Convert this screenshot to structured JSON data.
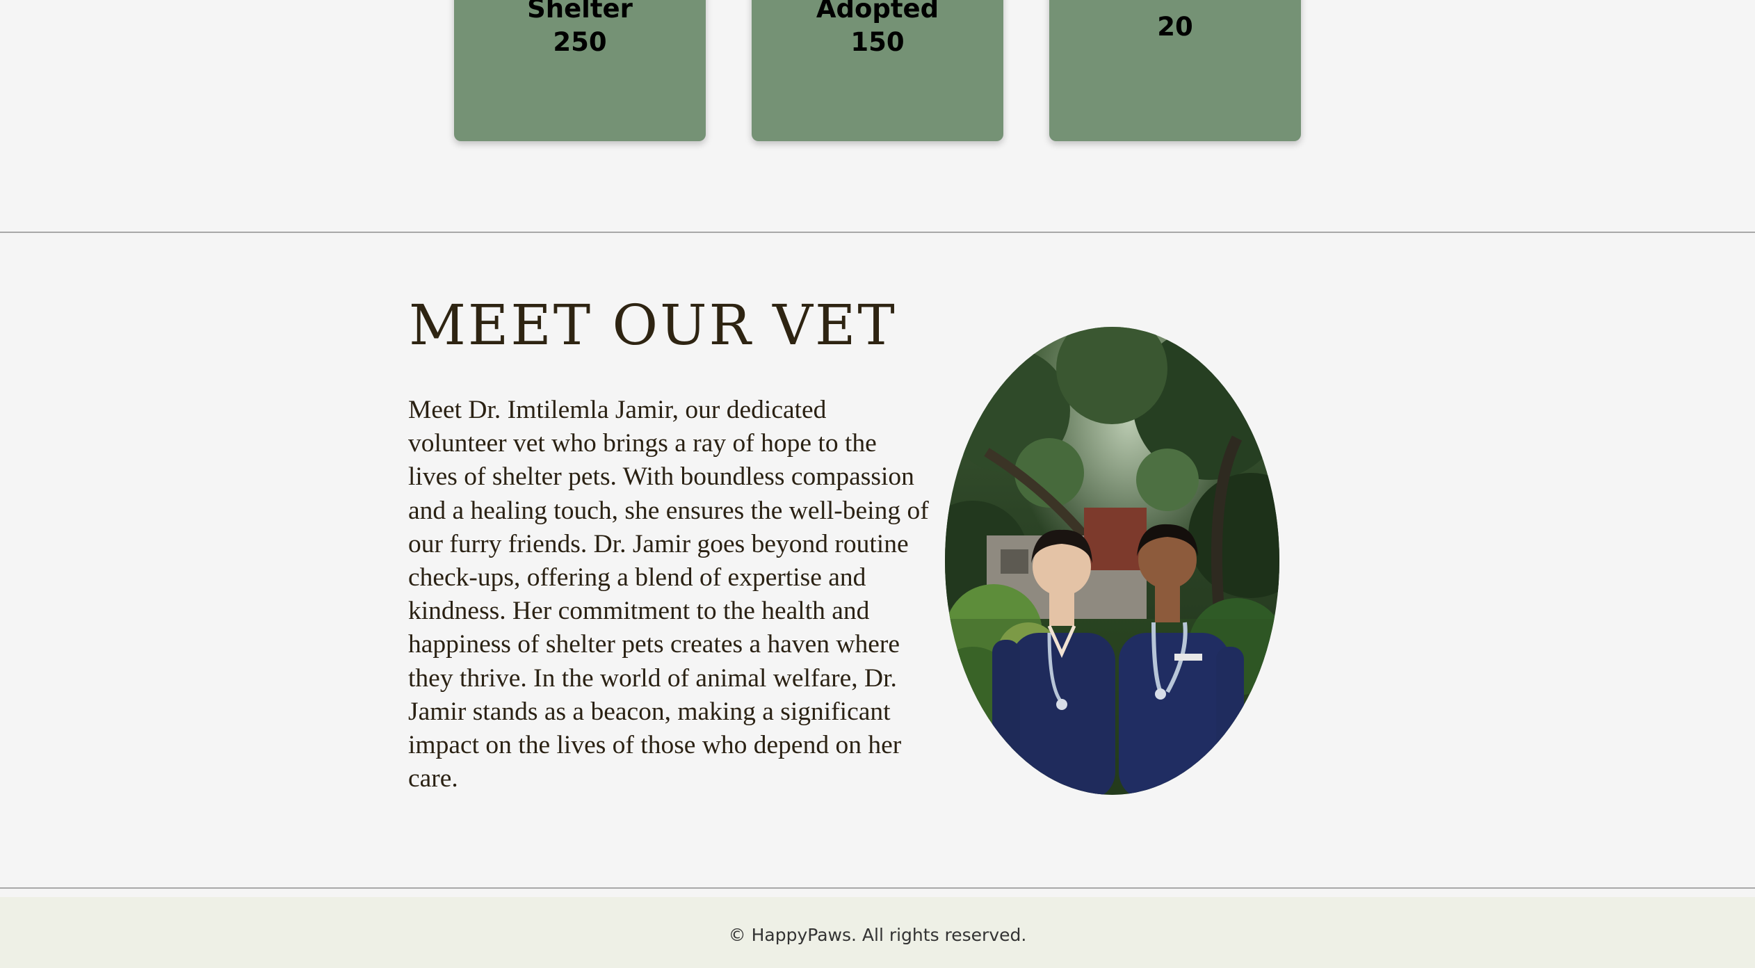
{
  "stats": [
    {
      "label": "Shelter",
      "value": "250"
    },
    {
      "label": "Adopted",
      "value": "150"
    },
    {
      "label": "",
      "value": "20"
    }
  ],
  "vet": {
    "title": "MEET OUR VET",
    "description": "Meet Dr. Imtilemla Jamir, our dedicated volunteer vet who brings a ray of hope to the lives of shelter pets. With boundless compassion and a healing touch, she ensures the well-being of our furry friends. Dr. Jamir goes beyond routine check-ups, offering a blend of expertise and kindness. Her commitment to the health and happiness of shelter pets creates a haven where they thrive. In the world of animal welfare, Dr. Jamir stands as a beacon, making a significant impact on the lives of those who depend on her care."
  },
  "footer": {
    "copyright": "© HappyPaws. All rights reserved."
  },
  "colors": {
    "card": "#759275",
    "title": "#2e2412",
    "footer_bg": "#eef0e6",
    "page_bg": "#f5f5f5"
  }
}
